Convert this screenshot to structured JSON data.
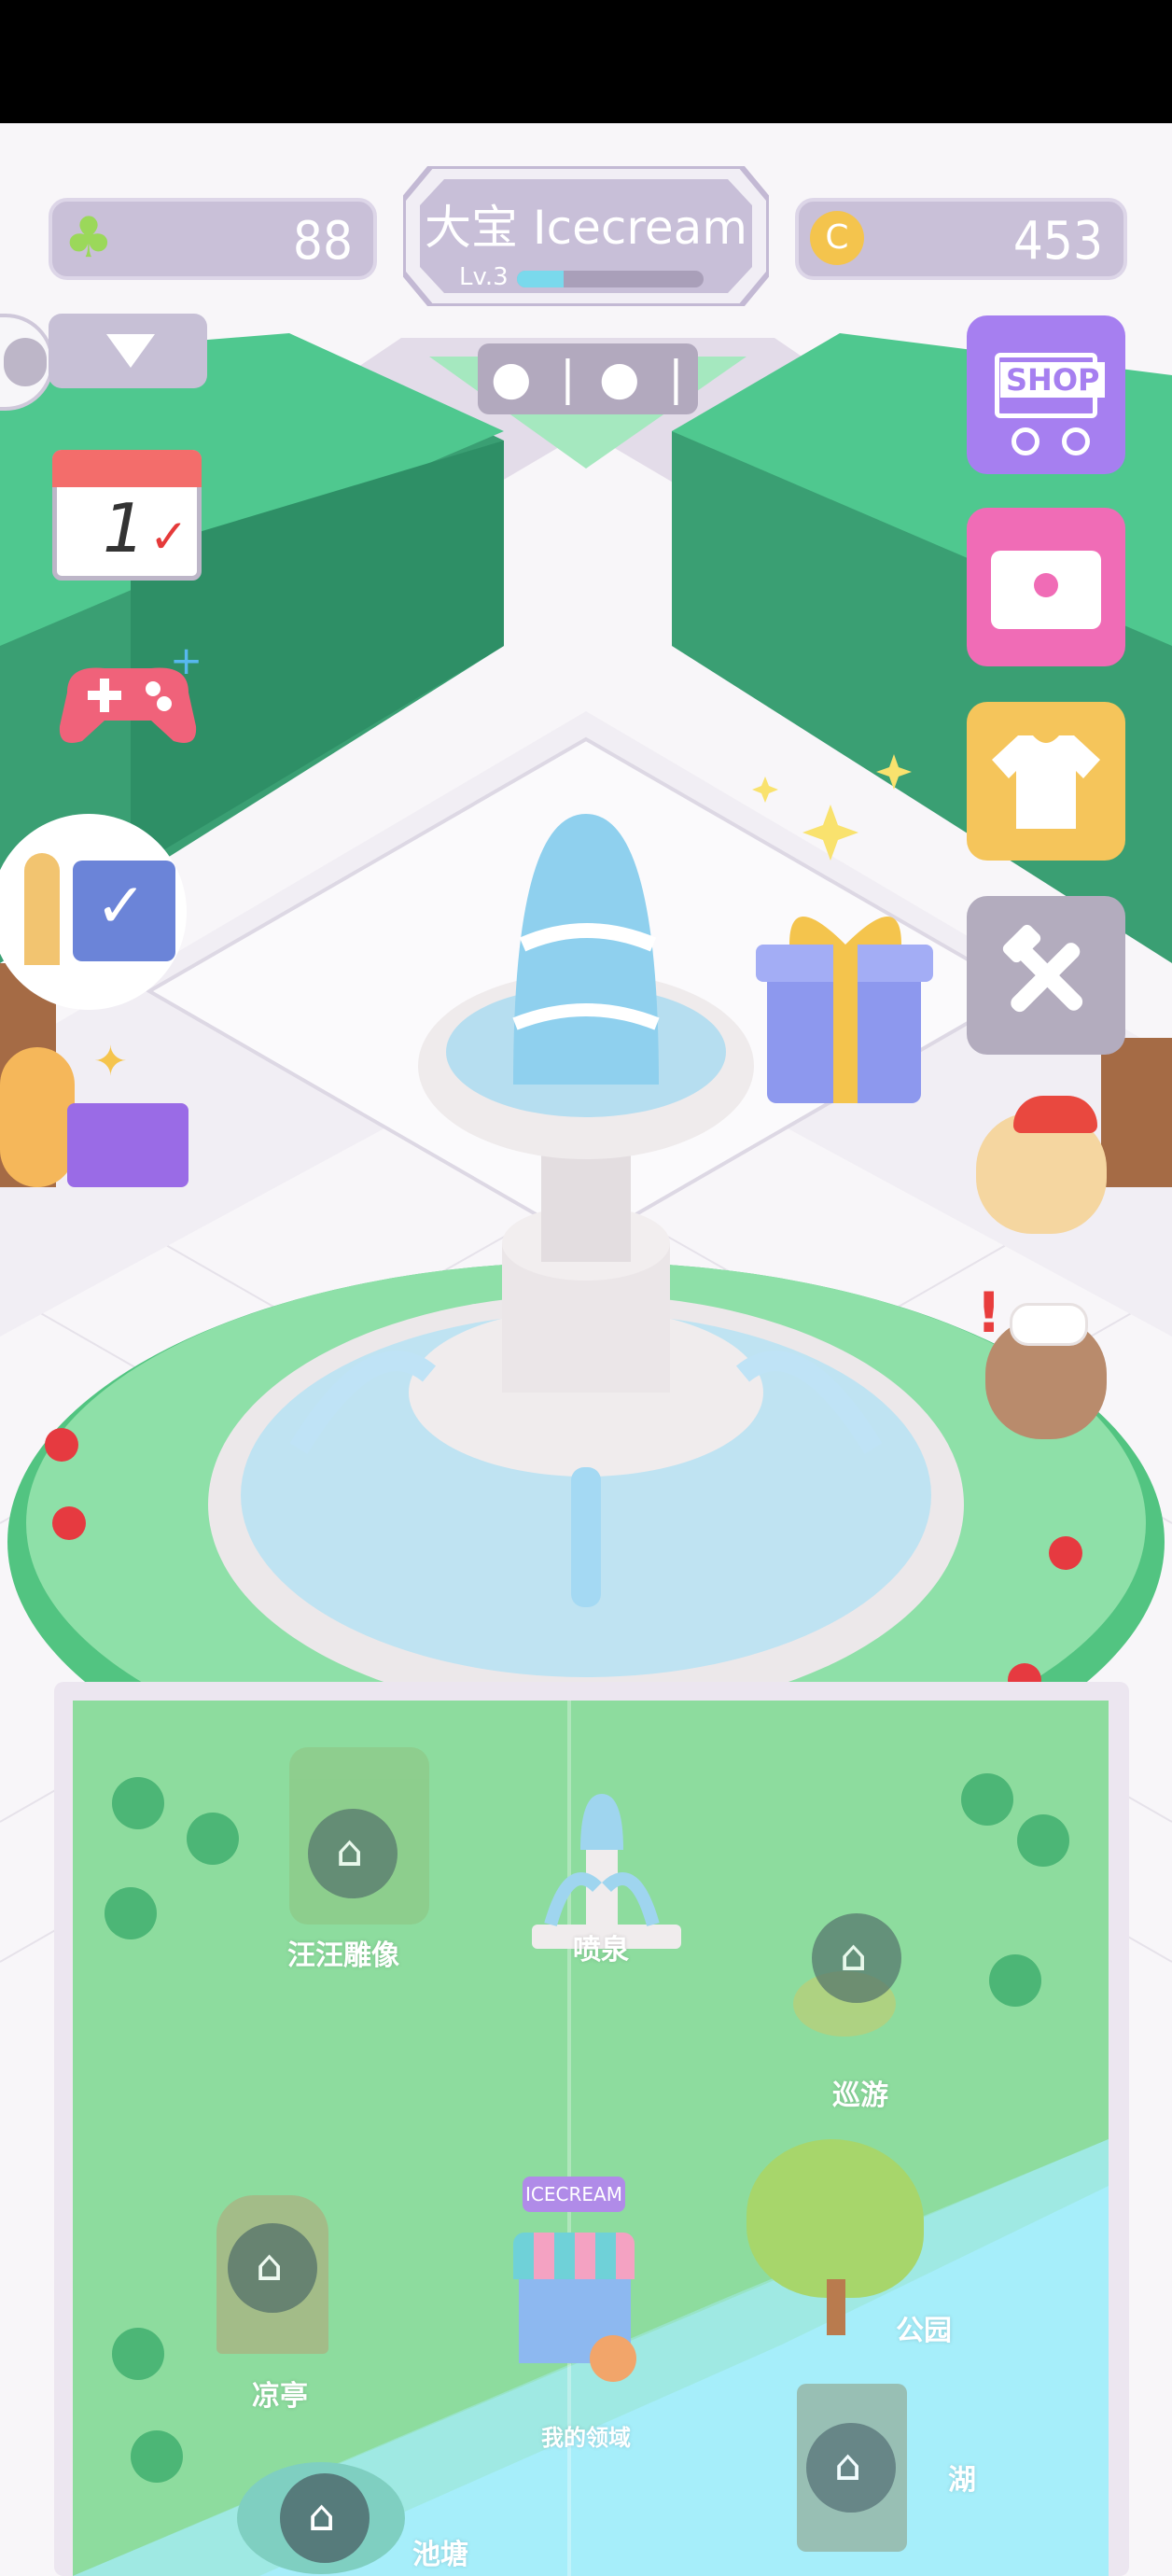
{
  "header": {
    "clover_count": "88",
    "player_name": "大宝 Icecream",
    "level": "Lv.3",
    "level_progress": 0.25,
    "coin_symbol": "C",
    "coin_count": "453"
  },
  "calendar": {
    "day": "1"
  },
  "shop": {
    "label": "SHOP"
  },
  "map": {
    "locations": [
      {
        "label": "汪汪雕像",
        "locked": true
      },
      {
        "label": "喷泉",
        "locked": false
      },
      {
        "label": "巡游",
        "locked": true
      },
      {
        "label": "凉亭",
        "locked": true
      },
      {
        "label": "我的领域",
        "locked": false
      },
      {
        "label": "公园",
        "locked": false
      },
      {
        "label": "池塘",
        "locked": true
      },
      {
        "label": "湖",
        "locked": true
      }
    ],
    "cart_sign": "ICECREAM"
  },
  "colors": {
    "hedge": "#47c18a",
    "grass": "#a5e8bf",
    "shop_btn": "#a57cf0",
    "chest_btn": "#f06cb6",
    "shirt_btn": "#f5c55b",
    "tools_btn": "#b3acbe",
    "map_green": "#8ddc9e",
    "map_water": "#a6eefa"
  }
}
